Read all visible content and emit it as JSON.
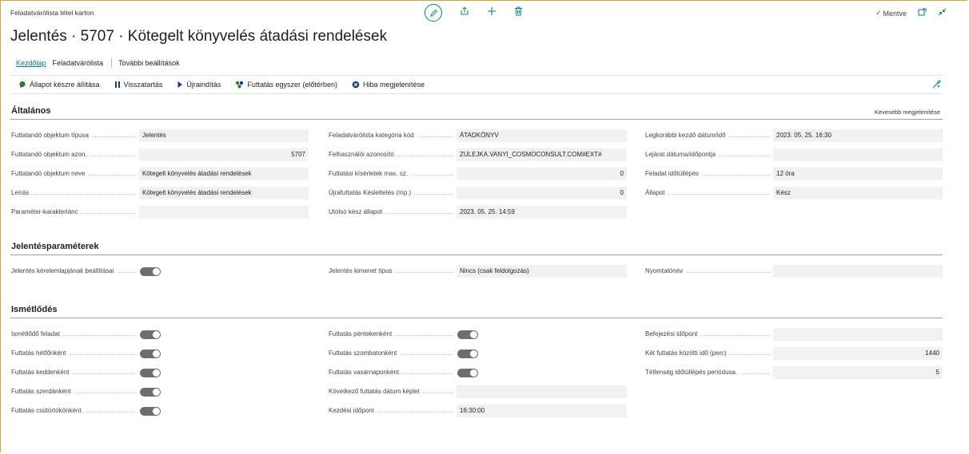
{
  "header": {
    "breadcrumb": "Feladatvárólista tétel karton",
    "saved_label": "Mentve",
    "title": "Jelentés · 5707 · Kötegelt könyvelés átadási rendelések"
  },
  "tabs": [
    {
      "label": "Kezdőlap",
      "active": true
    },
    {
      "label": "Feladatvárólista",
      "active": false
    },
    {
      "label": "További beállítások",
      "active": false
    }
  ],
  "actions": [
    {
      "label": "Állapot készre állítása",
      "icon": "status-ready-icon",
      "color": "#2e7d32"
    },
    {
      "label": "Visszatartás",
      "icon": "pause-icon",
      "color": "#1a3a8a"
    },
    {
      "label": "Újraindítás",
      "icon": "play-icon",
      "color": "#1a3a8a"
    },
    {
      "label": "Futtatás egyszer (előtérben)",
      "icon": "run-once-icon",
      "color": "#2e7d32"
    },
    {
      "label": "Hiba megjelenítése",
      "icon": "error-icon",
      "color": "#1a3a8a"
    }
  ],
  "general": {
    "title": "Általános",
    "less_link": "Kevesebb megjelenítése",
    "col1": [
      {
        "label": "Futtatandó objektum típusa",
        "value": "Jelentés",
        "num": false
      },
      {
        "label": "Futtatandó objektum azon.",
        "value": "5707",
        "num": true
      },
      {
        "label": "Futtatandó objektum neve",
        "value": "Kötegelt könyvelés átadási rendelések",
        "num": false
      },
      {
        "label": "Leírás",
        "value": "Kötegelt könyvelés átadási rendelések",
        "num": false
      },
      {
        "label": "Paraméter-karakterlánc",
        "value": "",
        "num": false
      }
    ],
    "col2": [
      {
        "label": "Feladatvárólista kategória kód",
        "value": "ÁTADKÖNYV",
        "num": false
      },
      {
        "label": "Felhasználói azonosító",
        "value": "ZULEJKA.VANYI_COSMOCONSULT.COM#EXT#",
        "num": false
      },
      {
        "label": "Futtatási kísérletek max. sz.",
        "value": "0",
        "num": true
      },
      {
        "label": "Újrafuttatás Késleltetés (mp.)",
        "value": "0",
        "num": true
      },
      {
        "label": "Utolsó kész állapot",
        "value": "2023. 05. 25. 14:59",
        "num": false
      }
    ],
    "col3": [
      {
        "label": "Legkorábbi kezdő dátum/idő",
        "value": "2023. 05. 25. 16:30",
        "num": false
      },
      {
        "label": "Lejárat dátuma/időpontja",
        "value": "",
        "num": false
      },
      {
        "label": "Feladat időtúllépés",
        "value": "12 óra",
        "num": false
      },
      {
        "label": "Állapot",
        "value": "Kész",
        "num": false
      }
    ]
  },
  "report_params": {
    "title": "Jelentésparaméterek",
    "request_page_label": "Jelentés kérelemlapjának beállításai",
    "output_type_label": "Jelentés kimenet típus",
    "output_type_value": "Nincs (csak feldolgozás)",
    "printer_label": "Nyomtatónév",
    "printer_value": ""
  },
  "recurrence": {
    "title": "Ismétlődés",
    "col1": [
      {
        "label": "Ismétlődő feladat"
      },
      {
        "label": "Futtatás hétfőnként"
      },
      {
        "label": "Futtatás keddenként"
      },
      {
        "label": "Futtatás szerdánként"
      },
      {
        "label": "Futtatás csütörtökönként"
      }
    ],
    "col2_toggles": [
      {
        "label": "Futtatás péntekenként"
      },
      {
        "label": "Futtatás szombatonként"
      },
      {
        "label": "Futtatás vasárnaponként"
      }
    ],
    "next_run_formula_label": "Következő futtatás dátum képlet",
    "next_run_formula_value": "",
    "start_time_label": "Kezdési időpont",
    "start_time_value": "16:30:00",
    "col3": [
      {
        "label": "Befejezési időpont",
        "value": "",
        "num": false
      },
      {
        "label": "Két futtatás közötti idő (perc)",
        "value": "1440",
        "num": true
      },
      {
        "label": "Tétlenség időtúllépés periódusa.",
        "value": "5",
        "num": true
      }
    ]
  },
  "colors": {
    "accent": "#00818a",
    "field_bg": "#f1f1f1",
    "toggle_bg": "#6e6e6e"
  }
}
